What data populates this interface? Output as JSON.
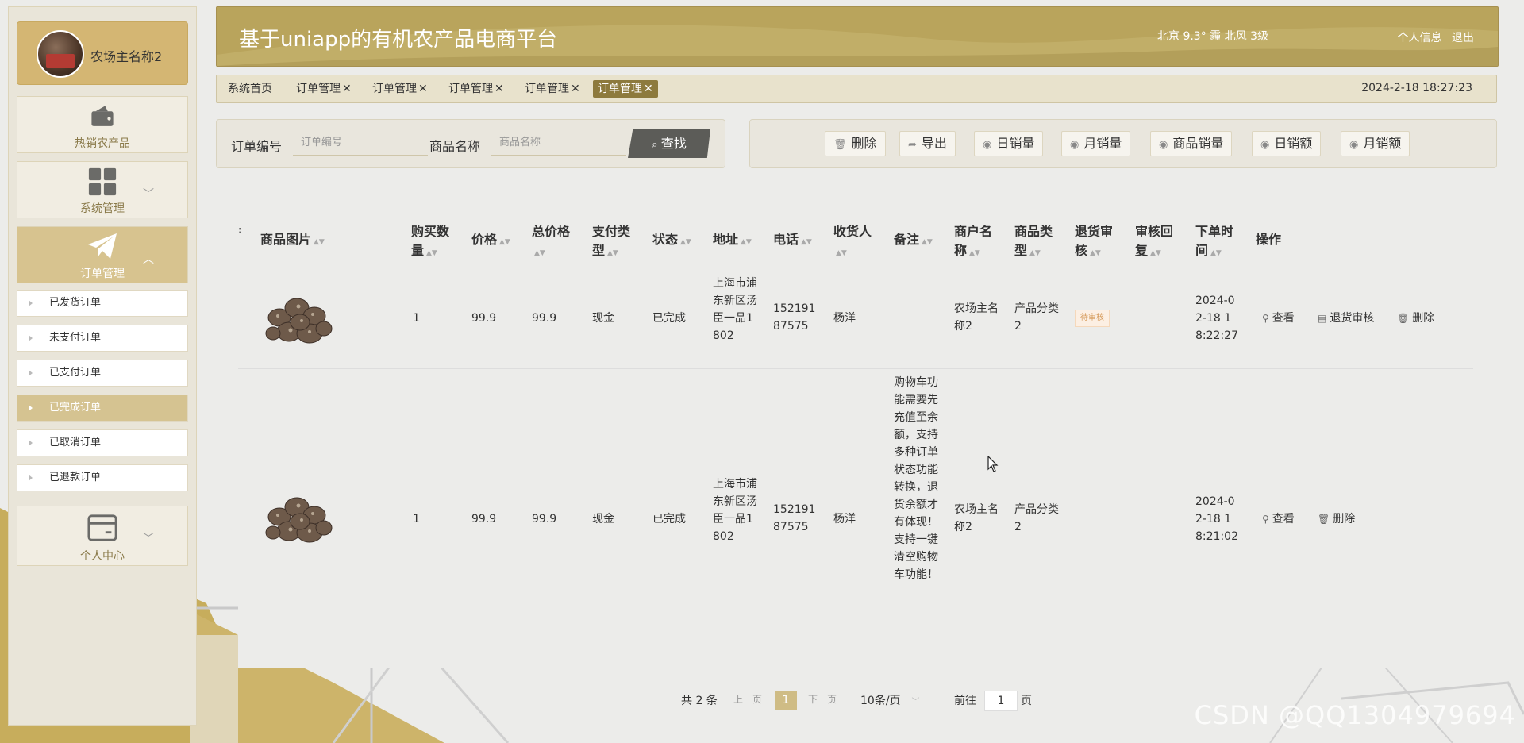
{
  "user": {
    "name": "农场主名称2"
  },
  "sidebar": {
    "tiles": [
      {
        "label": "热销农产品",
        "icon": "wallet-icon"
      },
      {
        "label": "系统管理",
        "icon": "grid-icon"
      },
      {
        "label": "订单管理",
        "icon": "paper-plane-icon"
      },
      {
        "label": "个人中心",
        "icon": "card-icon"
      }
    ],
    "sub_items": [
      "已发货订单",
      "未支付订单",
      "已支付订单",
      "已完成订单",
      "已取消订单",
      "已退款订单"
    ],
    "active_sub": "已完成订单"
  },
  "header": {
    "title": "基于uniapp的有机农产品电商平台",
    "weather": "北京  9.3°  霾  北风  3级",
    "profile": "个人信息",
    "logout": "退出"
  },
  "tabs": {
    "items": [
      "系统首页",
      "订单管理",
      "订单管理",
      "订单管理",
      "订单管理",
      "订单管理"
    ],
    "close": "✕",
    "datetime": "2024-2-18 18:27:23"
  },
  "search": {
    "order_no_label": "订单编号",
    "order_no_placeholder": "订单编号",
    "product_label": "商品名称",
    "product_placeholder": "商品名称",
    "search_button": "查找"
  },
  "actions": [
    "删除",
    "导出",
    "日销量",
    "月销量",
    "商品销量",
    "日销额",
    "月销额"
  ],
  "table": {
    "columns": {
      "image": "商品图片",
      "qty": "购买数量",
      "price": "价格",
      "total": "总价格",
      "pay": "支付类型",
      "status": "状态",
      "addr": "地址",
      "phone": "电话",
      "receiver": "收货人",
      "note": "备注",
      "merchant": "商户名称",
      "category": "商品类型",
      "refund": "退货审核",
      "reply": "审核回复",
      "time": "下单时间",
      "ops": "操作"
    },
    "rows": [
      {
        "qty": "1",
        "price": "99.9",
        "total": "99.9",
        "pay": "现金",
        "status": "已完成",
        "addr": "上海市浦东新区汤臣一品1802",
        "phone": "15219187575",
        "receiver": "杨洋",
        "note": "",
        "merchant": "农场主名称2",
        "category": "产品分类2",
        "refund": "待审核",
        "reply": "",
        "time": "2024-02-18 18:22:27",
        "ops": [
          "查看",
          "退货审核",
          "删除"
        ]
      },
      {
        "qty": "1",
        "price": "99.9",
        "total": "99.9",
        "pay": "现金",
        "status": "已完成",
        "addr": "上海市浦东新区汤臣一品1802",
        "phone": "15219187575",
        "receiver": "杨洋",
        "note": "购物车功能需要先充值至余额，支持多种订单状态功能转换，退货余额才有体现！支持一键清空购物车功能！",
        "merchant": "农场主名称2",
        "category": "产品分类2",
        "refund": "",
        "reply": "",
        "time": "2024-02-18 18:21:02",
        "ops": [
          "查看",
          "删除"
        ]
      }
    ]
  },
  "pagination": {
    "total": "共 2 条",
    "prev": "上一页",
    "current": "1",
    "next": "下一页",
    "page_size": "10条/页",
    "goto": "前往",
    "goto_value": "1",
    "page_unit": "页"
  },
  "watermark": "CSDN @QQ1304979694",
  "colors": {
    "accent": "#b9a45c",
    "active_tab": "#8d7a3d",
    "sidebar_bg": "#e9e5d9"
  }
}
